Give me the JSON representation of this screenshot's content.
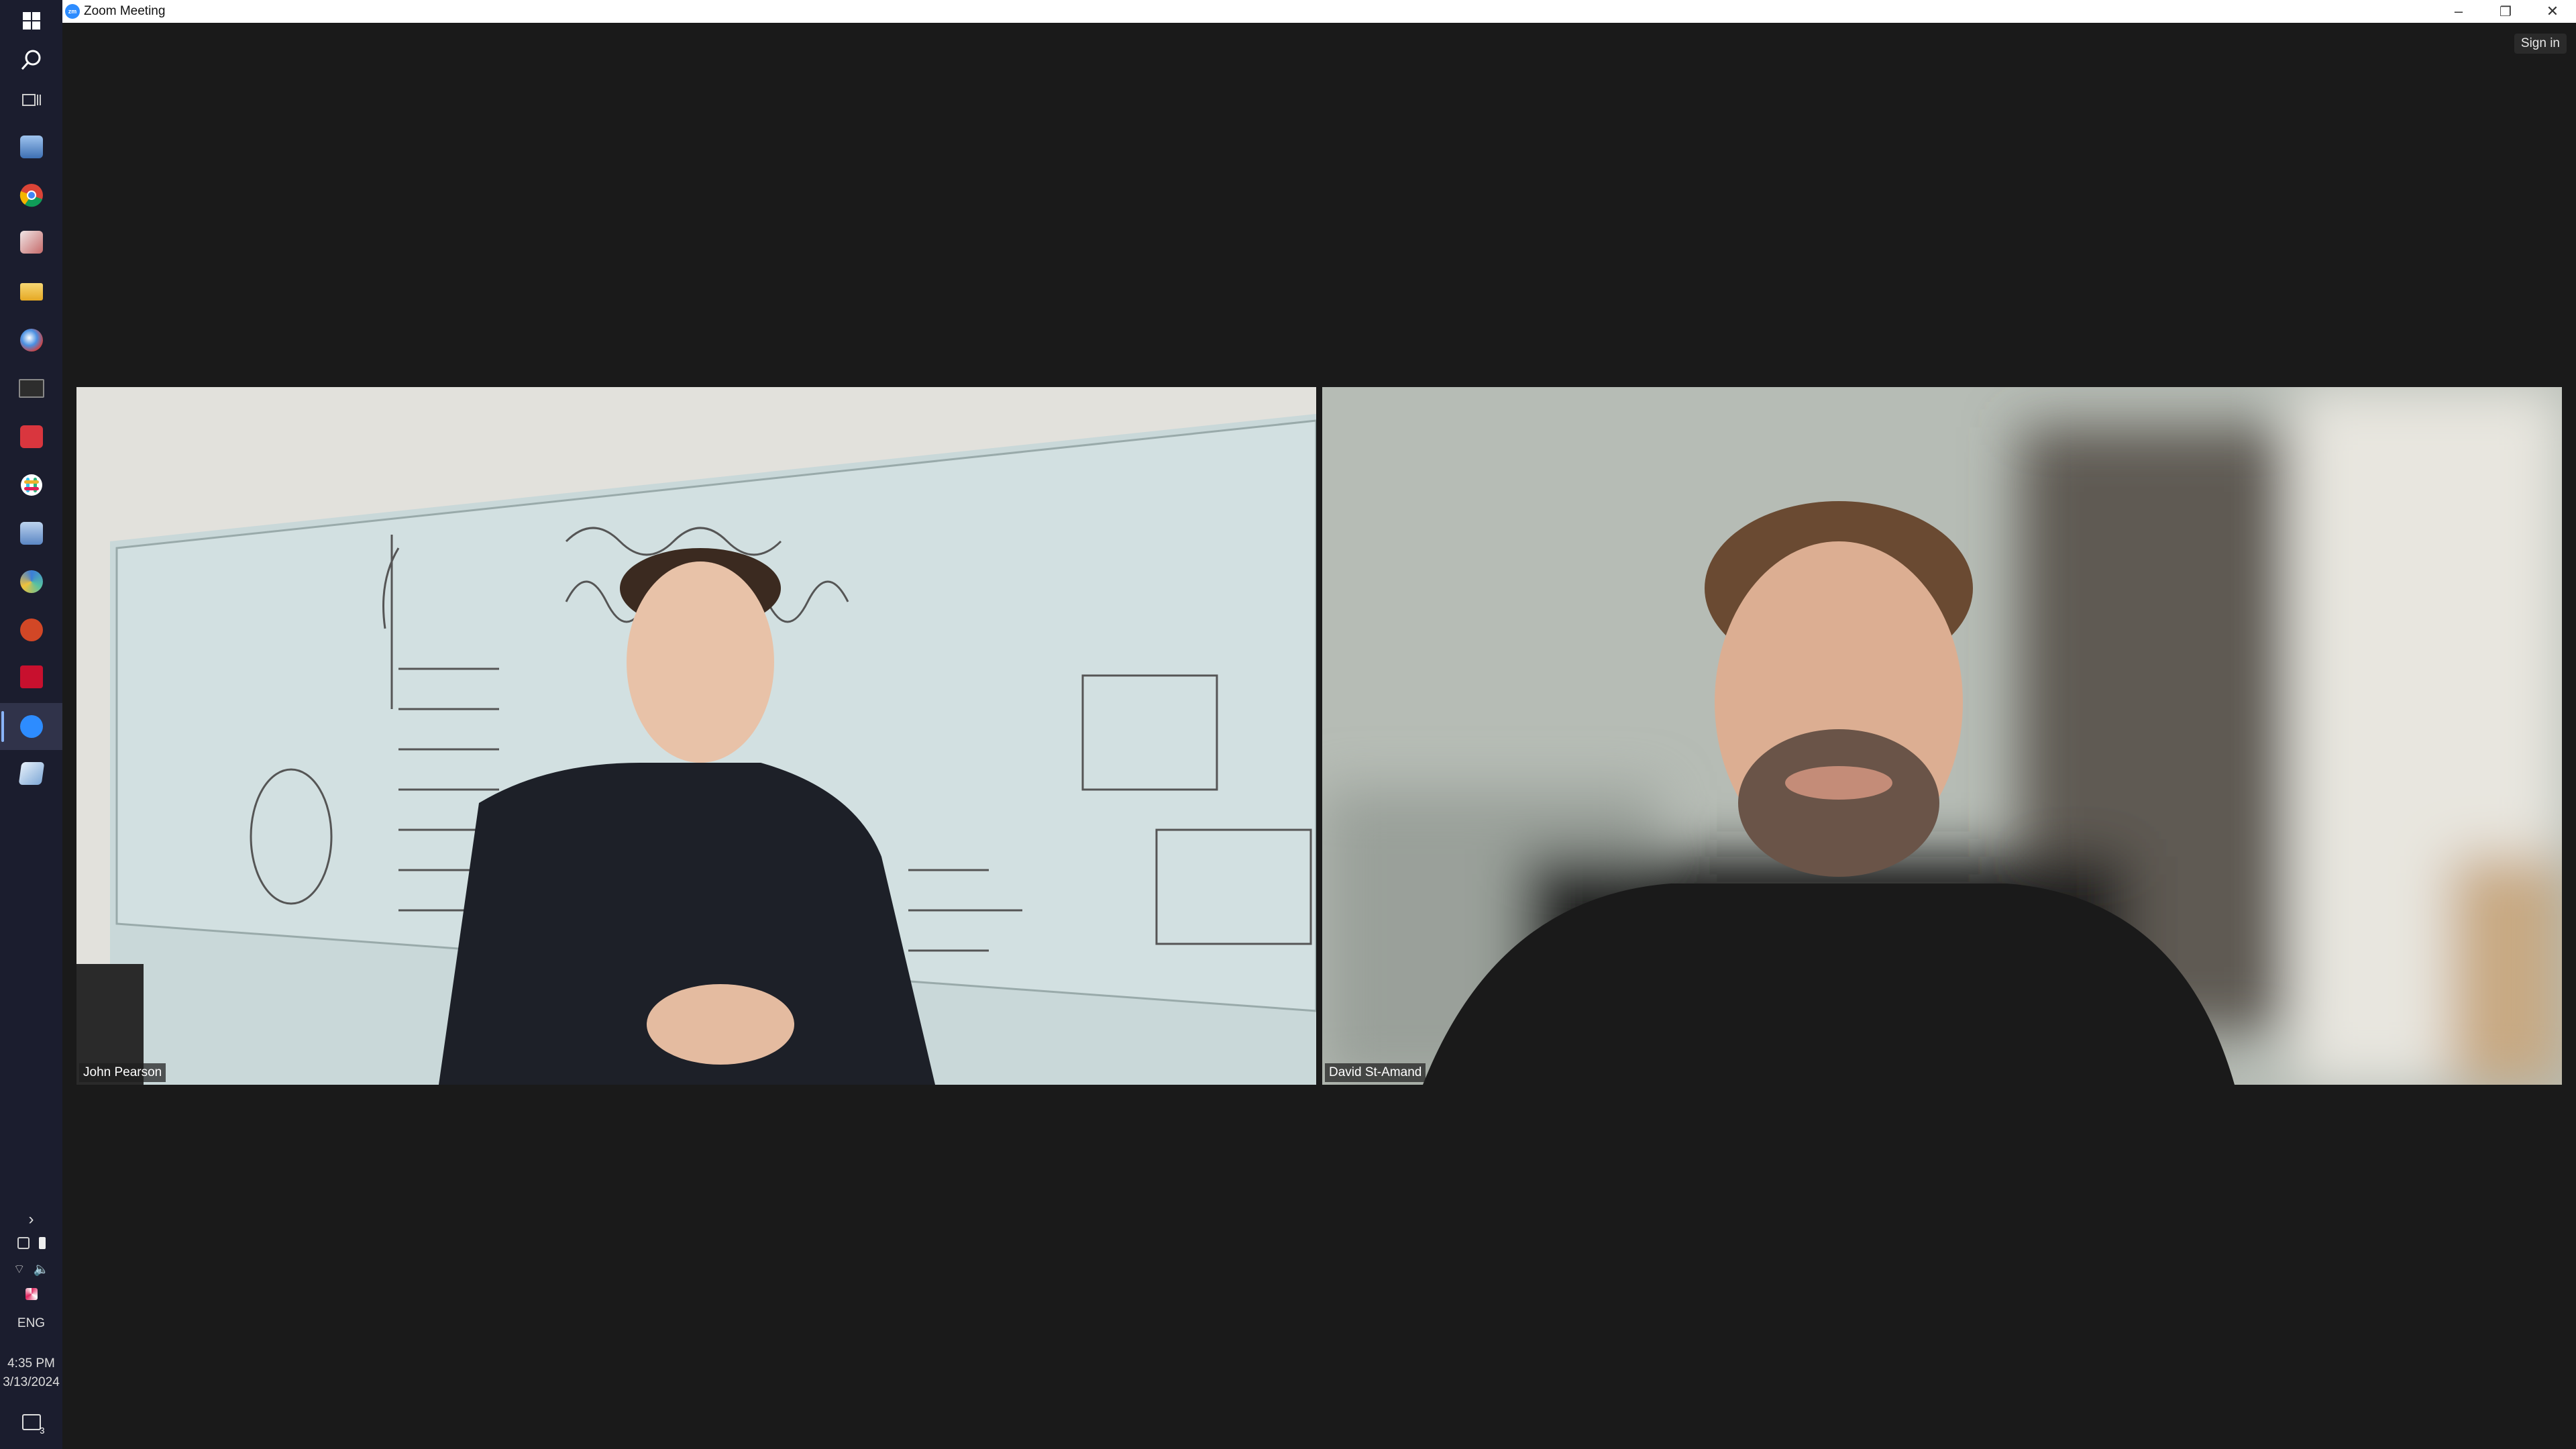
{
  "window": {
    "title": "Zoom Meeting",
    "app_icon": "zoom-logo-icon",
    "app_icon_text": "zm",
    "controls": {
      "minimize": "–",
      "restore": "❐",
      "close": "✕"
    }
  },
  "header": {
    "sign_in_label": "Sign in"
  },
  "participants": [
    {
      "name": "John Pearson"
    },
    {
      "name": "David St-Amand"
    }
  ],
  "taskbar": {
    "items": [
      {
        "icon": "windows-start-icon"
      },
      {
        "icon": "search-icon"
      },
      {
        "icon": "task-view-icon"
      },
      {
        "icon": "network-app-icon"
      },
      {
        "icon": "chrome-icon"
      },
      {
        "icon": "photos-app-icon"
      },
      {
        "icon": "file-explorer-icon"
      },
      {
        "icon": "paint-app-icon"
      },
      {
        "icon": "terminal-icon"
      },
      {
        "icon": "snipping-tool-icon"
      },
      {
        "icon": "slack-icon"
      },
      {
        "icon": "remote-desktop-icon"
      },
      {
        "icon": "spectrum-app-icon"
      },
      {
        "icon": "powerpoint-icon"
      },
      {
        "icon": "acrobat-icon"
      },
      {
        "icon": "zoom-icon",
        "active": true
      },
      {
        "icon": "notes-app-icon"
      }
    ],
    "tray": {
      "chevron": "›",
      "language": "ENG",
      "time": "4:35 PM",
      "date": "3/13/2024",
      "notification_count": "3"
    }
  },
  "colors": {
    "taskbar_bg": "#1b1d2e",
    "window_bg": "#1a1a1a",
    "zoom_blue": "#2d8cff"
  }
}
